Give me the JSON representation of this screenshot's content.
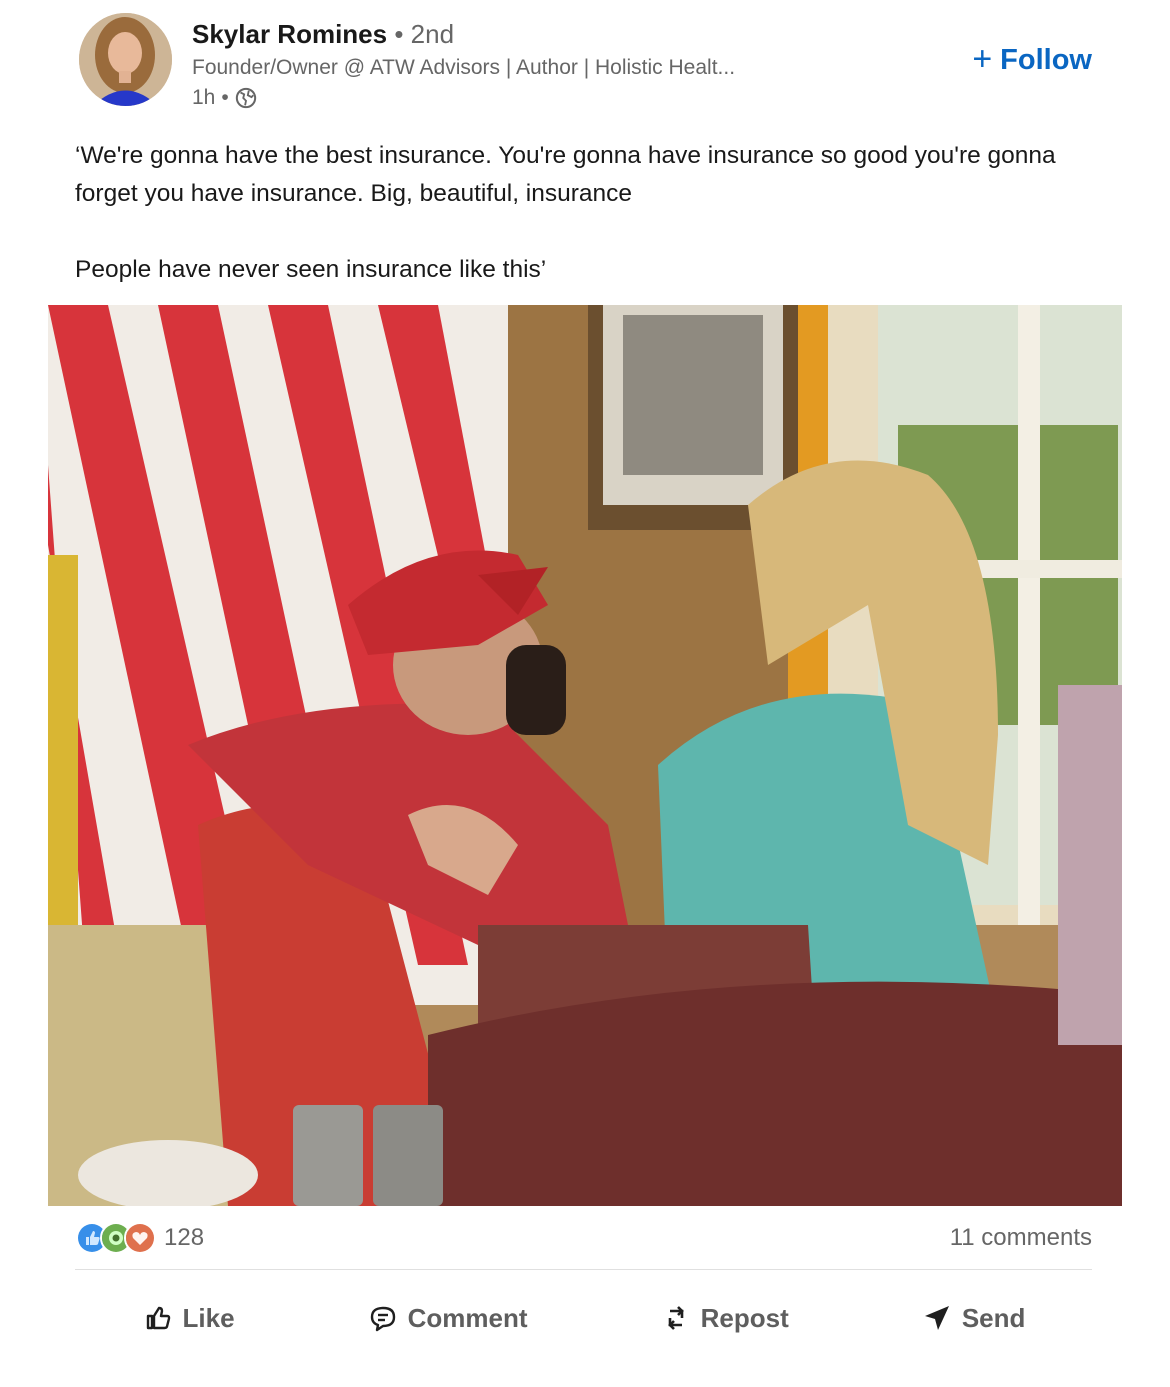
{
  "post": {
    "author": {
      "name": "Skylar Romines",
      "separator": " • ",
      "degree": "2nd",
      "headline": "Founder/Owner @ ATW Advisors | Author | Holistic Healt...",
      "time": "1h",
      "time_separator": " •",
      "visibility_icon": "globe-icon"
    },
    "follow_label": "Follow",
    "follow_icon": "+",
    "text": {
      "line1": "‘We're gonna have the best insurance. You're gonna have insurance so good you're gonna forget you have insurance. Big, beautiful, insurance",
      "line2": "People have never seen insurance like this’"
    },
    "image": {
      "description_icon": "photo"
    },
    "reactions": {
      "icons": [
        "like-reaction-icon",
        "celebrate-reaction-icon",
        "love-reaction-icon"
      ],
      "count": "128"
    },
    "comments_count": "11 comments",
    "actions": {
      "like": "Like",
      "comment": "Comment",
      "repost": "Repost",
      "send": "Send"
    }
  },
  "colors": {
    "accent": "#0a66c2",
    "text_secondary": "#666666",
    "like_blue": "#378fe9",
    "celebrate_green": "#44712e",
    "love_red": "#df704d"
  }
}
